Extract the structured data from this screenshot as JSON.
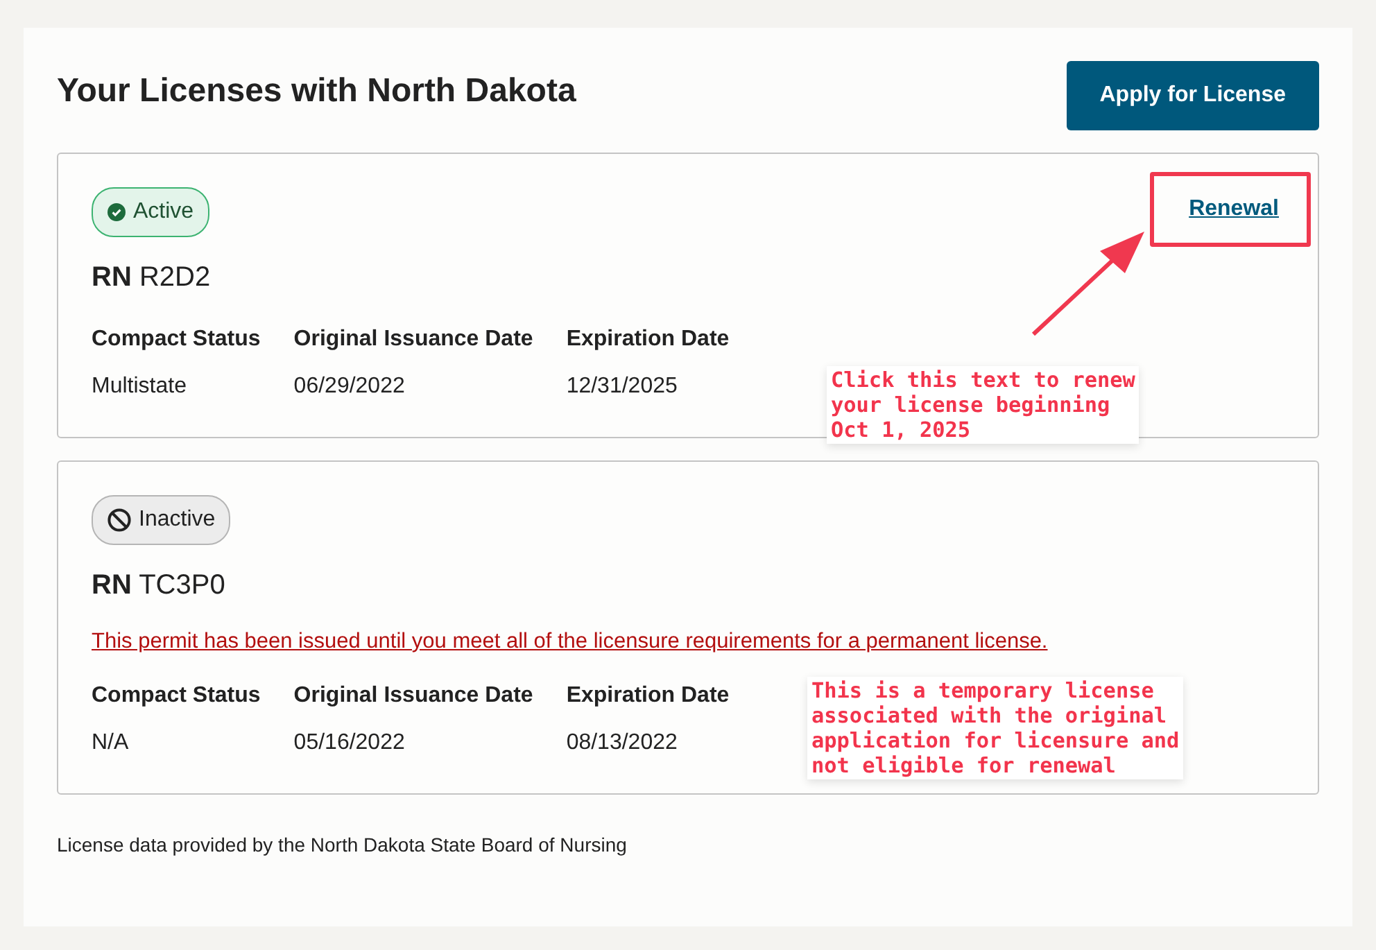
{
  "title": "Your Licenses with North Dakota",
  "apply_button": "Apply for License",
  "licenses": [
    {
      "status": {
        "label": "Active",
        "kind": "active"
      },
      "type": "RN",
      "number": "R2D2",
      "action_link": "Renewal",
      "details": [
        {
          "label": "Compact Status",
          "value": "Multistate"
        },
        {
          "label": "Original Issuance Date",
          "value": "06/29/2022"
        },
        {
          "label": "Expiration Date",
          "value": "12/31/2025"
        }
      ],
      "annotation": {
        "lines": [
          "Click this text to renew",
          "your license beginning",
          "Oct 1, 2025"
        ],
        "kind": "callout"
      }
    },
    {
      "status": {
        "label": "Inactive",
        "kind": "inactive"
      },
      "type": "RN",
      "number": "TC3P0",
      "notice": "This permit has been issued until you meet all of the licensure requirements for a permanent license.",
      "details": [
        {
          "label": "Compact Status",
          "value": "N/A"
        },
        {
          "label": "Original Issuance Date",
          "value": "05/16/2022"
        },
        {
          "label": "Expiration Date",
          "value": "08/13/2022"
        }
      ],
      "annotation": {
        "lines": [
          "This is a temporary license",
          "associated with the original",
          "application for licensure and",
          "not eligible for renewal"
        ],
        "kind": "note"
      }
    }
  ],
  "footer": "License data provided by the North Dakota State Board of Nursing"
}
